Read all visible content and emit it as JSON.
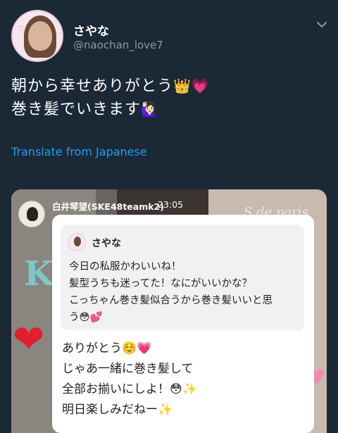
{
  "user": {
    "display_name": "さやな",
    "handle": "@naochan_love7",
    "avatar_icon": "profile-photo",
    "avatar_deco": "♡"
  },
  "tweet": {
    "line1": "朝から幸せありがとう",
    "line1_emoji": "👑💗",
    "line2": "巻き髪でいきます",
    "line2_emoji": "🙋🏻‍♀️"
  },
  "translate_label": "Translate from Japanese",
  "colors": {
    "background": "#1b2836",
    "link": "#1da1f2",
    "muted": "#8899a6"
  },
  "media": {
    "poster_name": "白井琴望(SKE48teamk2)",
    "poster_time": "23:05",
    "sign_text": "S de paris",
    "wall_letter": "K",
    "quote": {
      "name": "さやな",
      "lines": [
        "今日の私服かわいいね！",
        "髪型うちも迷ってた！なにがいいかな？",
        "こっちゃん巻き髪似合うから巻き髪いいと思",
        "う😳💕"
      ]
    },
    "reply": {
      "lines": [
        "ありがとう☺️💗",
        "じゃあ一緒に巻き髪して",
        "全部お揃いにしよ！😳✨",
        "明日楽しみだねー✨"
      ]
    }
  }
}
